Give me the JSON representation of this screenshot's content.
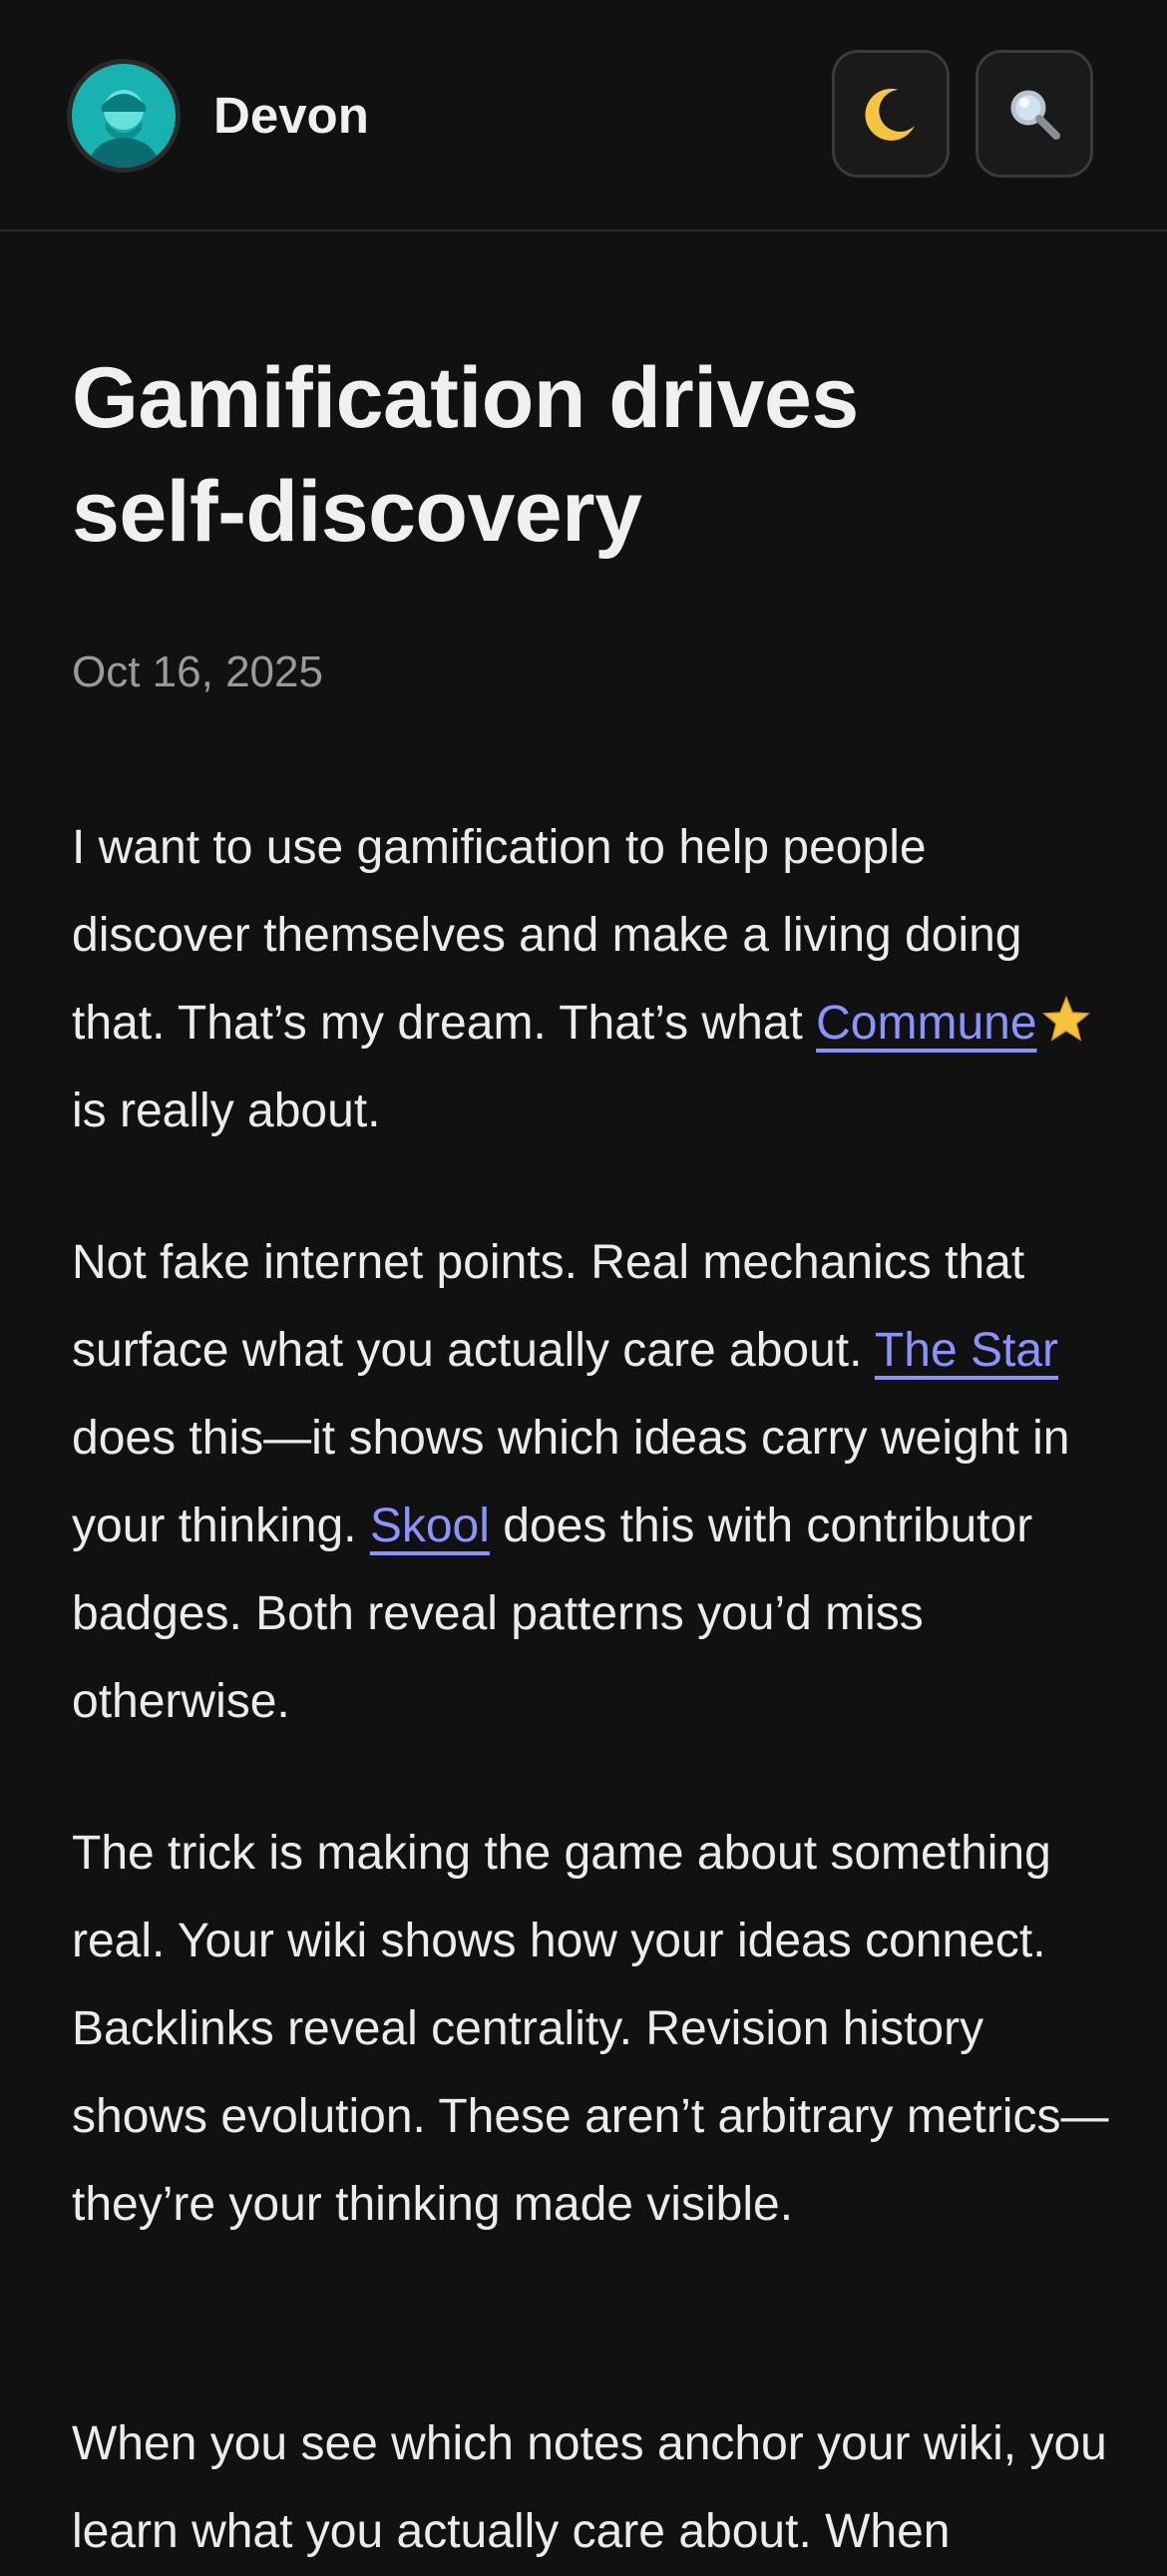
{
  "header": {
    "site_name": "Devon",
    "theme_icon": "moon-icon",
    "search_icon": "search-icon"
  },
  "article": {
    "title_line1": "Gamification drives",
    "title_line2": "self-discovery",
    "date": "Oct 16, 2025",
    "p1": {
      "text_before": "I want to use gamification to help people discover themselves and make a living doing that. That’s my dream. That’s what ",
      "link": "Commune",
      "text_after": " is really about."
    },
    "p2": {
      "t1": "Not fake internet points. Real mechanics that surface what you actually care about. ",
      "link1": "The Star",
      "t2": " does this—it shows which ideas carry weight in your thinking. ",
      "link2": "Skool",
      "t3": " does this with contributor badges. Both reveal patterns you’d miss otherwise."
    },
    "p3": "The trick is making the game about something real. Your wiki shows how your ideas connect. Backlinks reveal centrality. Revision history shows evolution. These aren’t arbitrary metrics—they’re your thinking made visible.",
    "p4": "When you see which notes anchor your wiki, you learn what you actually care about. When"
  },
  "colors": {
    "background": "#111111",
    "text": "#ececec",
    "muted": "#9a9a9a",
    "link": "#8a93ff",
    "avatar": "#14a9a8"
  }
}
